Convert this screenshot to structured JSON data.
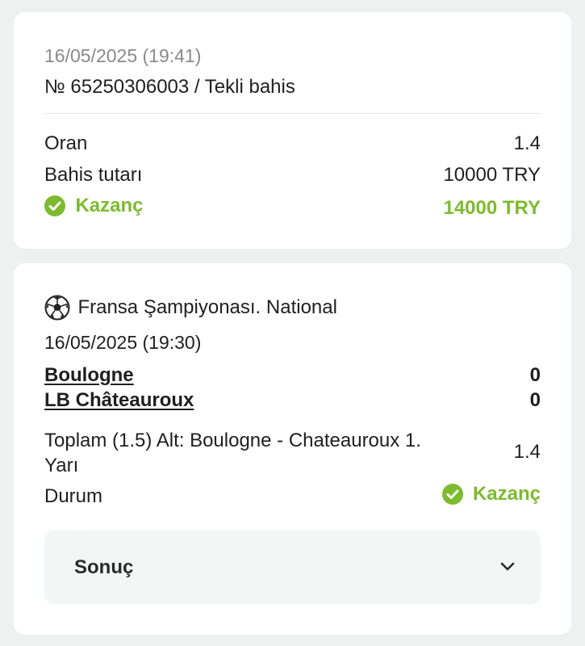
{
  "bet": {
    "datetime": "16/05/2025 (19:41)",
    "ticket": "№ 65250306003 / Tekli bahis",
    "odds_label": "Oran",
    "odds_value": "1.4",
    "stake_label": "Bahis tutarı",
    "stake_value": "10000 TRY",
    "win_label": "Kazanç",
    "win_value": "14000 TRY"
  },
  "event": {
    "sport_icon": "soccer-ball-icon",
    "league": "Fransa Şampiyonası. National",
    "datetime": "16/05/2025 (19:30)",
    "home_team": "Boulogne",
    "home_score": "0",
    "away_team": "LB Châteauroux",
    "away_score": "0",
    "market_line1": "Toplam (1.5) Alt: Boulogne - Chateauroux 1.",
    "market_line2": "Yarı",
    "market_odds": "1.4",
    "status_label": "Durum",
    "status_value": "Kazanç",
    "result_label": "Sonuç"
  },
  "colors": {
    "background": "#edf2f0",
    "card": "#ffffff",
    "success": "#7cbc2c",
    "result_box": "#f2f7f6"
  }
}
